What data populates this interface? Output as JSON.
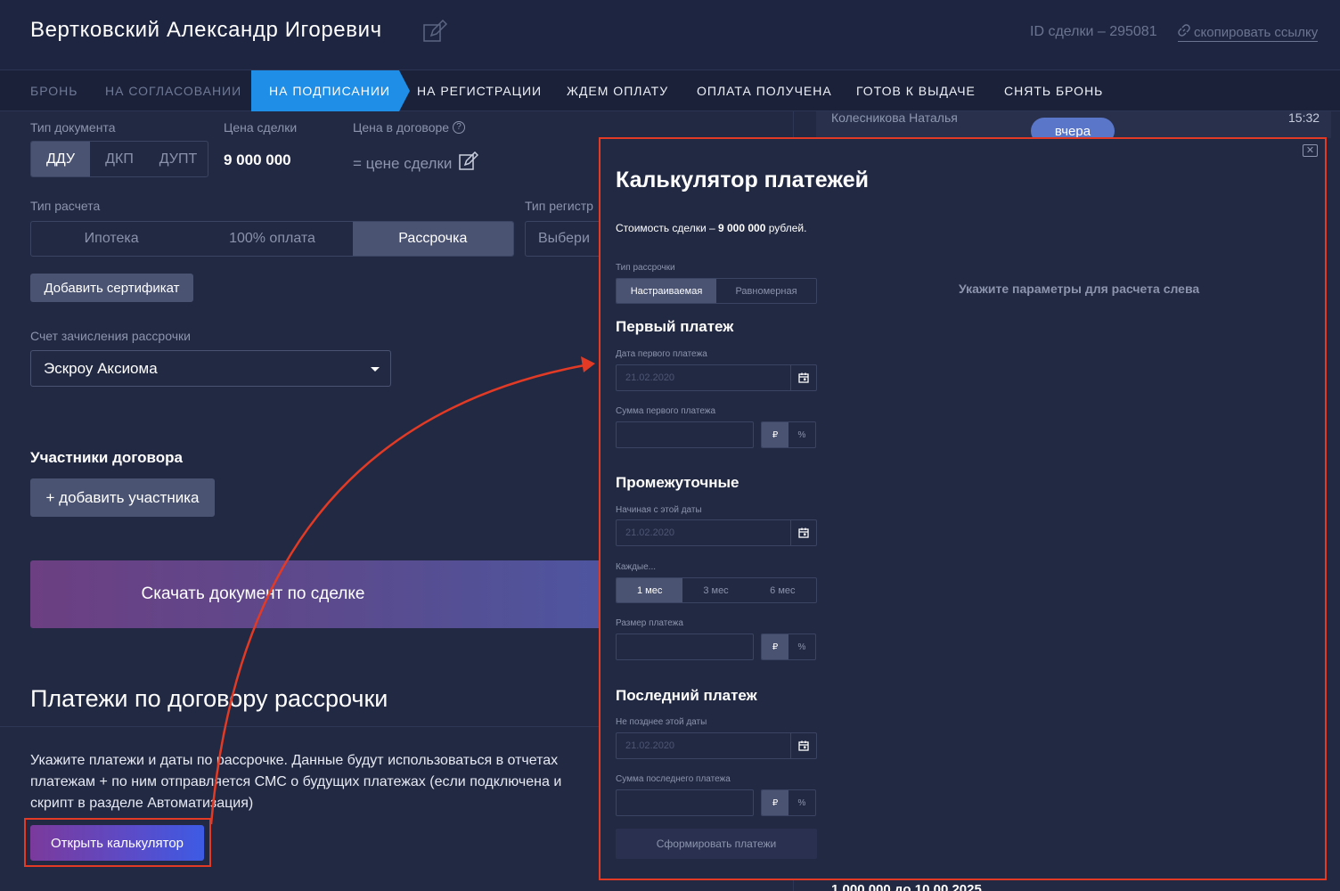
{
  "header": {
    "client_name": "Вертковский Александр Игоревич",
    "deal_id": "ID сделки – 295081",
    "copy_link": "скопировать ссылку"
  },
  "stages": [
    {
      "label": "Бронь",
      "state": "done"
    },
    {
      "label": "На согласовании",
      "state": "done"
    },
    {
      "label": "На подписании",
      "state": "active"
    },
    {
      "label": "На регистрации",
      "state": "next"
    },
    {
      "label": "Ждем оплату",
      "state": "next"
    },
    {
      "label": "Оплата получена",
      "state": "next"
    },
    {
      "label": "Готов к выдаче",
      "state": "next"
    },
    {
      "label": "Снять бронь",
      "state": "next"
    }
  ],
  "document": {
    "type_label": "Тип документа",
    "types": [
      "ДДУ",
      "ДКП",
      "ДУПТ"
    ],
    "selected_type": "ДДУ",
    "price_label": "Цена сделки",
    "price": "9 000 000",
    "contract_price_label": "Цена в договоре",
    "contract_price": "= цене сделки"
  },
  "payment": {
    "type_label": "Тип расчета",
    "types": [
      "Ипотека",
      "100% оплата",
      "Рассрочка"
    ],
    "selected": "Рассрочка",
    "reg_label": "Тип регистр",
    "reg_placeholder": "Выбери"
  },
  "add_certificate": "Добавить сертификат",
  "account": {
    "label": "Счет зачисления рассрочки",
    "value": "Эскроу Аксиома"
  },
  "participants": {
    "title": "Участники договора",
    "add_button": "+ добавить участника"
  },
  "download_button": "Скачать документ по сделке",
  "installments": {
    "title": "Платежи по договору рассрочки",
    "help_lines": [
      "Укажите платежи и даты по рассрочке. Данные будут использоваться в отчетах",
      "платежам + по ним отправляется СМС о будущих платежах (если подключена и",
      "скрипт в разделе Автоматизация)"
    ],
    "open_calc": "Открыть калькулятор"
  },
  "chat": {
    "name": "Колесникова Наталья",
    "time": "15:32",
    "badge": "вчера",
    "bottom": "1 000 000 до 10.00.2025"
  },
  "modal": {
    "title": "Калькулятор платежей",
    "cost_prefix": "Стоимость сделки – ",
    "cost_value": "9 000 000",
    "cost_suffix": " рублей.",
    "hint": "Укажите параметры для расчета слева",
    "installment_type_label": "Тип рассрочки",
    "installment_types": [
      "Настраиваемая",
      "Равномерная"
    ],
    "installment_selected": "Настраиваемая",
    "first": {
      "title": "Первый платеж",
      "date_label": "Дата первого платежа",
      "date_placeholder": "21.02.2020",
      "sum_label": "Сумма первого платежа"
    },
    "intermediate": {
      "title": "Промежуточные",
      "from_label": "Начиная с этой даты",
      "from_placeholder": "21.02.2020",
      "every_label": "Каждые...",
      "periods": [
        "1 мес",
        "3 мес",
        "6 мес"
      ],
      "period_selected": "1 мес",
      "size_label": "Размер платежа"
    },
    "last": {
      "title": "Последний платеж",
      "date_label": "Не позднее этой даты",
      "date_placeholder": "21.02.2020",
      "sum_label": "Сумма последнего платежа"
    },
    "units": [
      "₽",
      "%"
    ],
    "generate_button": "Сформировать платежи"
  },
  "colors": {
    "background": "#222943",
    "accent": "#1f8ee6",
    "highlight": "#e23a25"
  }
}
